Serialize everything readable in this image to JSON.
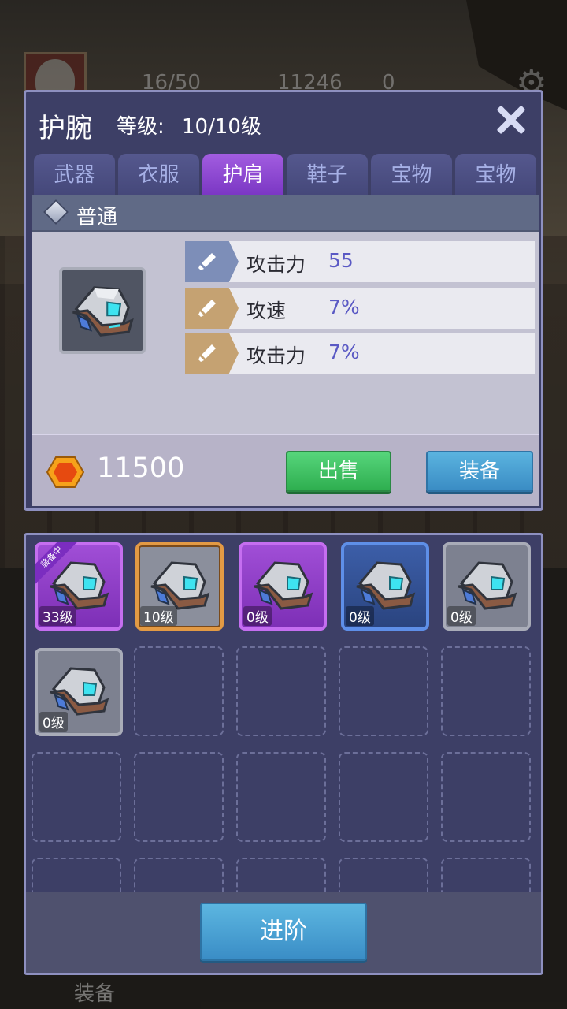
{
  "hud": {
    "energy": "16/50",
    "gold": "11246",
    "gem": "0"
  },
  "panel": {
    "title": "护腕",
    "level_label": "等级:",
    "level_value": "10/10级",
    "tabs": [
      {
        "label": "武器",
        "active": false
      },
      {
        "label": "衣服",
        "active": false
      },
      {
        "label": "护肩",
        "active": true
      },
      {
        "label": "鞋子",
        "active": false
      },
      {
        "label": "宝物",
        "active": false
      },
      {
        "label": "宝物",
        "active": false
      }
    ],
    "rarity": "普通",
    "stats": [
      {
        "name": "攻击力",
        "value": "55",
        "color": "#7d8eb8"
      },
      {
        "name": "攻速",
        "value": "7%",
        "color": "#c5a272"
      },
      {
        "name": "攻击力",
        "value": "7%",
        "color": "#c5a272"
      }
    ],
    "price": "11500",
    "sell_label": "出售",
    "equip_label": "装备"
  },
  "inventory": {
    "items": [
      {
        "level": "33级",
        "rarity": "purple",
        "equipped_tag": "装备中"
      },
      {
        "level": "10级",
        "rarity": "orange"
      },
      {
        "level": "0级",
        "rarity": "purple"
      },
      {
        "level": "0级",
        "rarity": "blue"
      },
      {
        "level": "0级",
        "rarity": "gray"
      },
      {
        "level": "0级",
        "rarity": "gray"
      }
    ],
    "advance_label": "进阶"
  },
  "background": {
    "bottom_label": "装备"
  },
  "colors": {
    "panel_bg": "#3d3f66",
    "active_tab": "#a25de0",
    "sell_button": "#2eae4f",
    "equip_button": "#3a8cc4",
    "stat_value": "#5a59c4"
  }
}
